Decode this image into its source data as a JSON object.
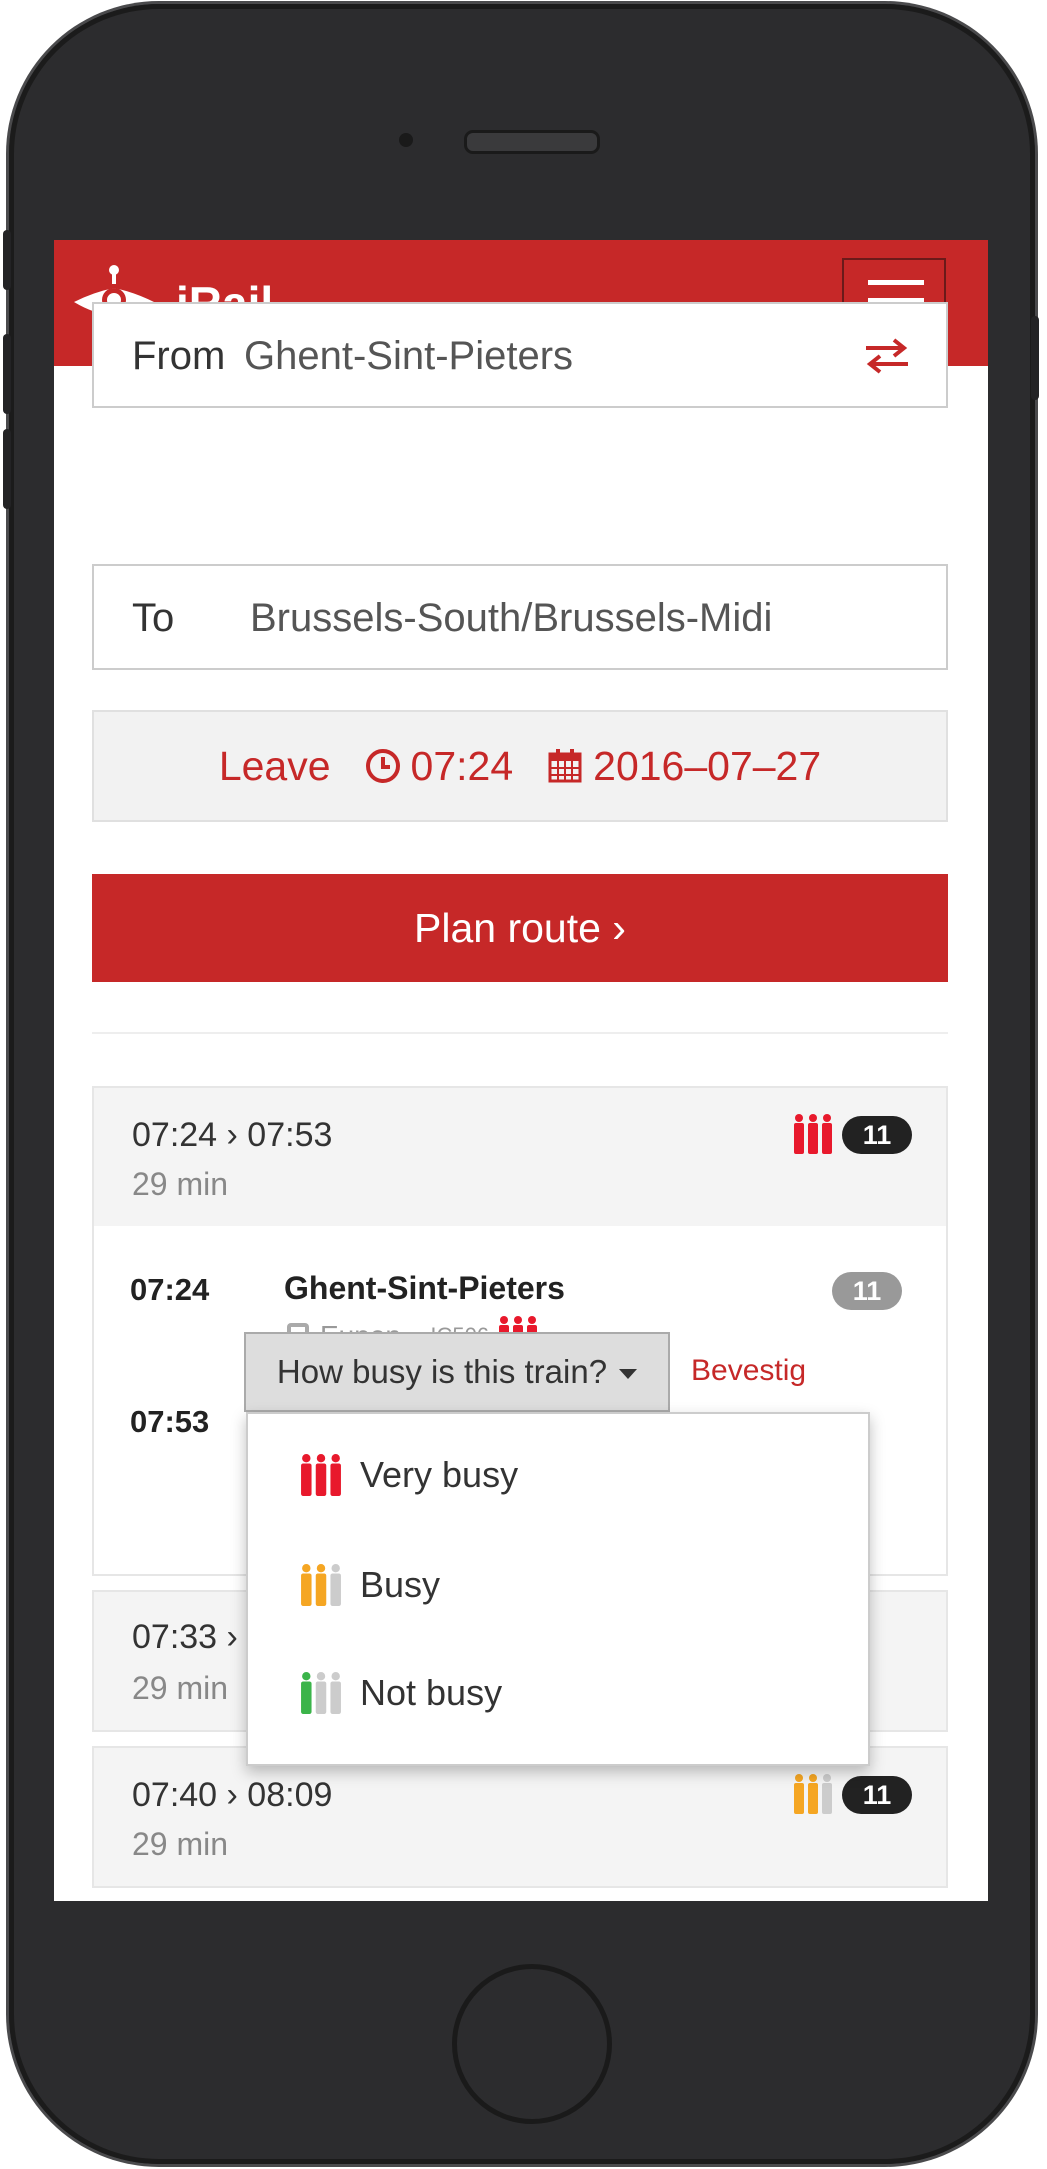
{
  "app": {
    "brand": "iRail"
  },
  "form": {
    "from_label": "From",
    "from_value": "Ghent-Sint-Pieters",
    "to_label": "To",
    "to_value": "Brussels-South/Brussels-Midi",
    "when_mode": "Leave",
    "time": "07:24",
    "date": "2016–07–27",
    "plan_button": "Plan route ›"
  },
  "results": [
    {
      "times": "07:24 › 07:53",
      "duration": "29 min",
      "occupancy": "very-busy",
      "transfers": "11"
    },
    {
      "times": "07:33 › 08",
      "duration": "29 min"
    },
    {
      "times": "07:40 › 08:09",
      "duration": "29 min",
      "occupancy": "busy",
      "transfers": "11"
    }
  ],
  "detail": {
    "dep_time": "07:24",
    "station": "Ghent-Sint-Pieters",
    "platform": "11",
    "direction": "Eupen –",
    "train_id": "IC506",
    "arr_time": "07:53"
  },
  "occupancy": {
    "dropdown_label": "How busy is this train?",
    "confirm": "Bevestig",
    "options": [
      {
        "label": "Very busy",
        "color": "#e8192c"
      },
      {
        "label": "Busy",
        "color": "#f5a623"
      },
      {
        "label": "Not busy",
        "color": "#3bb44a"
      }
    ],
    "inactive_color": "#cccccc"
  },
  "colors": {
    "brand": "#c62828"
  }
}
